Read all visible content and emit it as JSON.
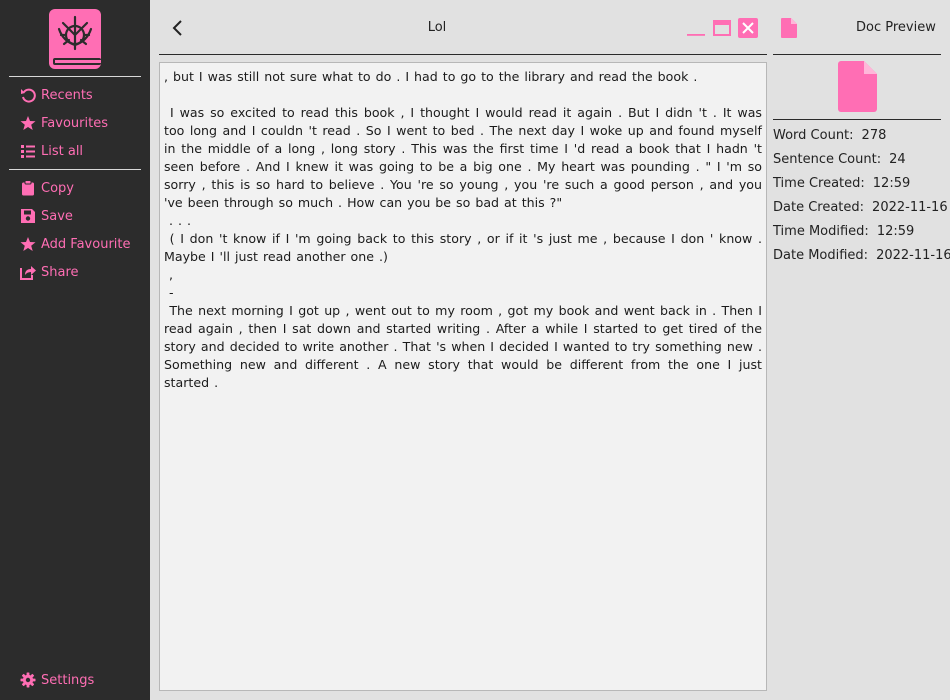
{
  "window": {
    "title": "Lol"
  },
  "sidebar": {
    "nav": [
      {
        "label": "Recents",
        "icon": "undo-icon"
      },
      {
        "label": "Favourites",
        "icon": "star-icon"
      },
      {
        "label": "List all",
        "icon": "list-icon"
      }
    ],
    "actions": [
      {
        "label": "Copy",
        "icon": "clipboard-icon"
      },
      {
        "label": "Save",
        "icon": "save-icon"
      },
      {
        "label": "Add Favourite",
        "icon": "star-icon"
      },
      {
        "label": "Share",
        "icon": "share-icon"
      }
    ],
    "settings_label": "Settings"
  },
  "editor": {
    "paragraphs": [
      ", but I was still not sure what to do . I had to go to the library and read the book .",
      "",
      " I was so excited to read this book , I thought I would read it again . But I didn 't . It was too long and I couldn 't read . So I went to bed . The next day I woke up and found myself in the middle of a long , long story . This was the first time I 'd read a book that I hadn 't seen before . And I knew it was going to be a big one . My heart was pounding . \" I 'm so sorry , this is so hard to believe . You 're so young , you 're such a good person , and you 've been through so much . How can you be so bad at this ?\"",
      " . . .",
      " ( I don 't know if I 'm going back to this story , or if it 's just me , because I don ' know . Maybe I 'll just read another one .)",
      " ,",
      " -",
      " The next morning I got up , went out to my room , got my book and went back in . Then I read again , then I sat down and started writing . After a while I started to get tired of the story and decided to write another . That 's when I decided I wanted to try something new . Something new and different . A new story that would be different from the one I just started ."
    ]
  },
  "preview": {
    "label": "Doc Preview",
    "stats": [
      {
        "label": "Word Count:",
        "value": "278"
      },
      {
        "label": "Sentence Count:",
        "value": "24"
      },
      {
        "label": "Time Created:",
        "value": "12:59"
      },
      {
        "label": "Date Created:",
        "value": "2022-11-16"
      },
      {
        "label": "Time Modified:",
        "value": "12:59"
      },
      {
        "label": "Date Modified:",
        "value": "2022-11-16"
      }
    ]
  },
  "colors": {
    "accent": "#ff6eb4",
    "sidebar_bg": "#2c2c2c",
    "page_bg": "#e1e1e1",
    "editor_bg": "#f2f2f2"
  }
}
